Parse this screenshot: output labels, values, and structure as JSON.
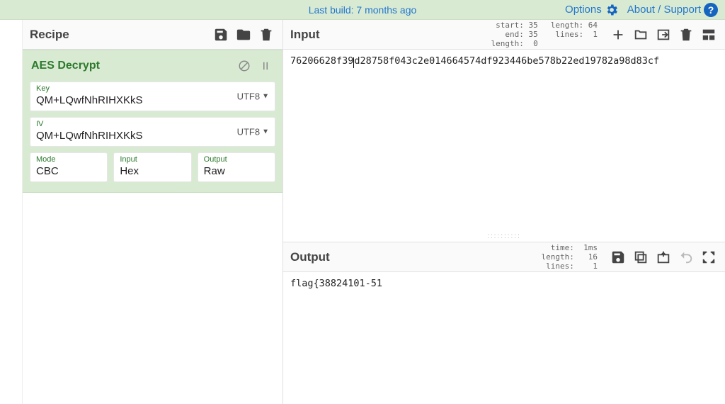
{
  "banner": {
    "build_text": "Last build: 7 months ago",
    "options": "Options",
    "about": "About / Support"
  },
  "recipe": {
    "title": "Recipe",
    "operation": {
      "name": "AES Decrypt",
      "key": {
        "label": "Key",
        "value": "QM+LQwfNhRIHXKkS",
        "encoding": "UTF8"
      },
      "iv": {
        "label": "IV",
        "value": "QM+LQwfNhRIHXKkS",
        "encoding": "UTF8"
      },
      "mode": {
        "label": "Mode",
        "value": "CBC"
      },
      "inputf": {
        "label": "Input",
        "value": "Hex"
      },
      "outputf": {
        "label": "Output",
        "value": "Raw"
      }
    }
  },
  "input": {
    "title": "Input",
    "meta_left": " start: 35\n   end: 35\nlength:  0",
    "meta_right": "length: 64\n lines:  1",
    "text_before_caret": "76206628f39",
    "text_after_caret": "d28758f043c2e014664574df923446be578b22ed19782a98d83cf"
  },
  "output": {
    "title": "Output",
    "meta": "  time:  1ms\nlength:   16\n lines:    1",
    "text": "flag{38824101-51"
  }
}
